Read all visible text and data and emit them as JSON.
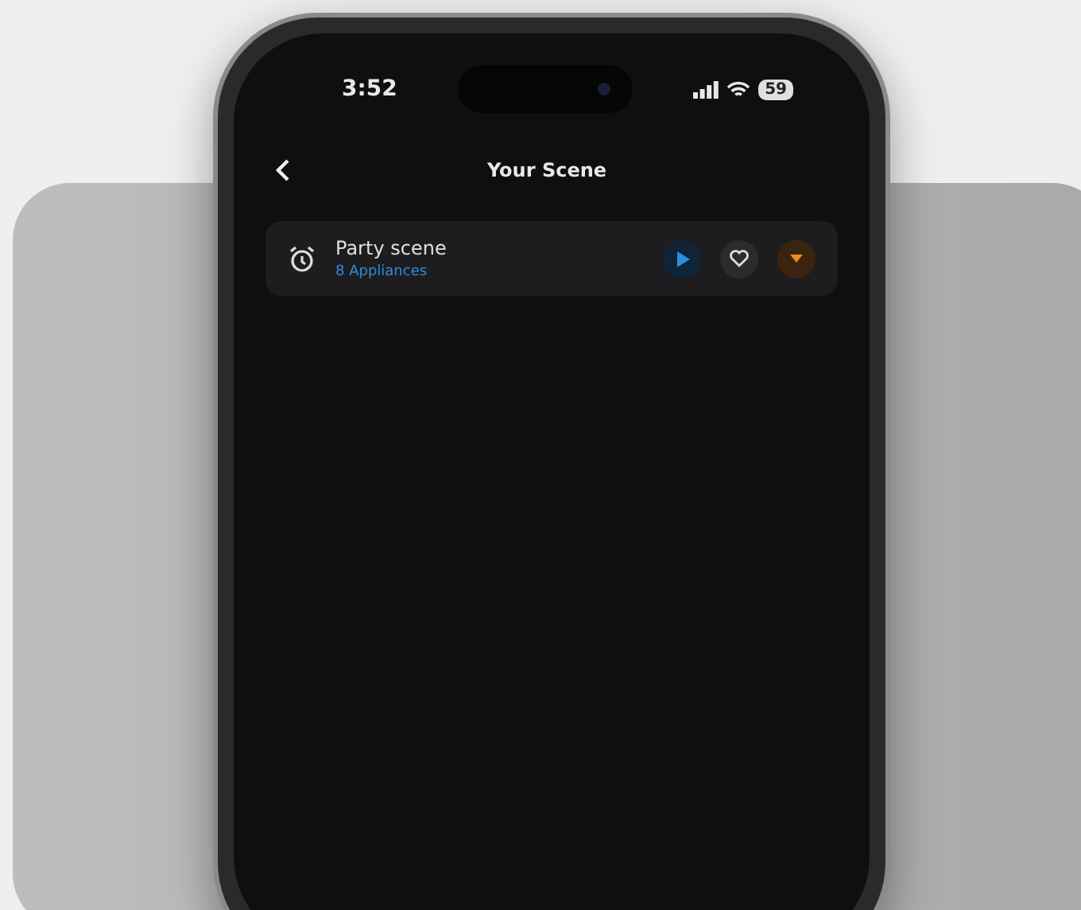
{
  "status_bar": {
    "time": "3:52",
    "battery": "59"
  },
  "header": {
    "title": "Your Scene"
  },
  "scenes": [
    {
      "name": "Party scene",
      "subtitle": "8 Appliances",
      "favorite": false
    }
  ]
}
